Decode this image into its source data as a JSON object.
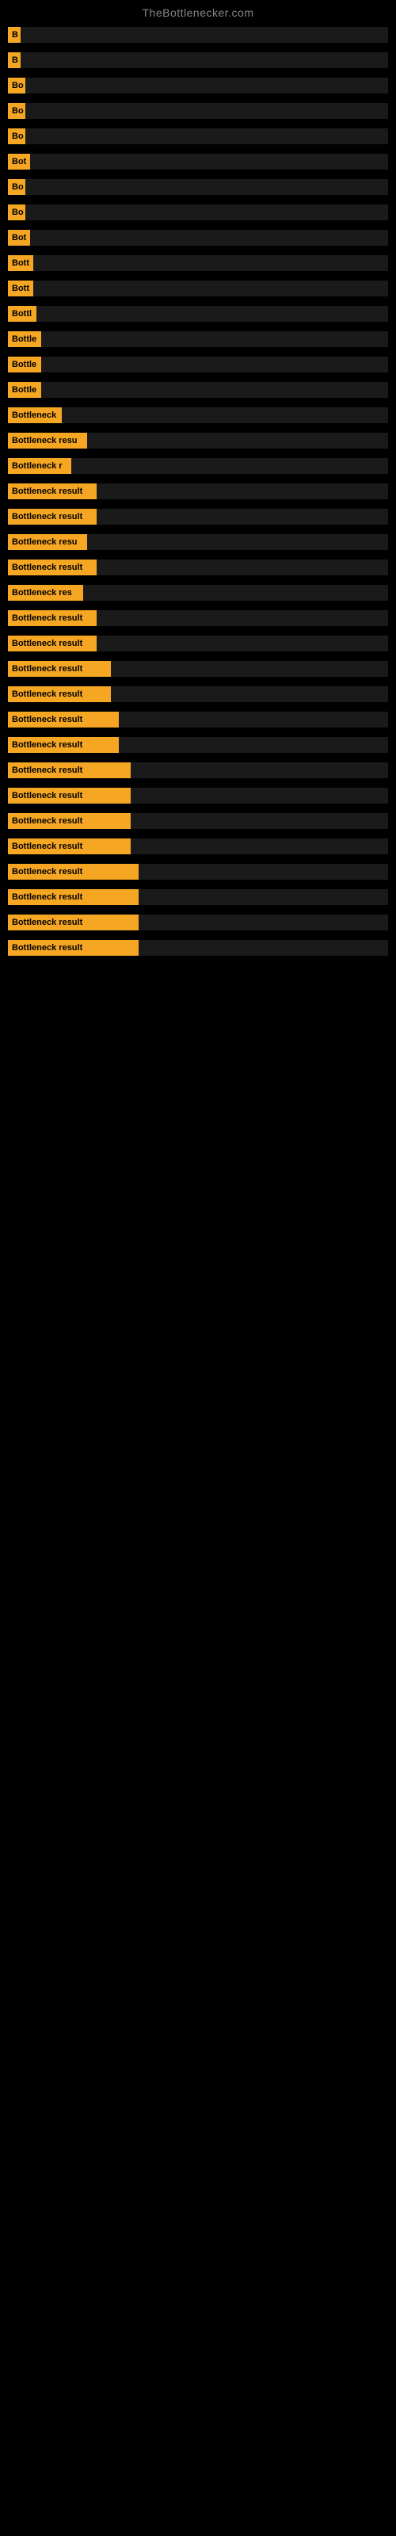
{
  "site_title": "TheBottlenecker.com",
  "rows": [
    {
      "label": "B",
      "label_width": 16,
      "bar_visible": true
    },
    {
      "label": "B",
      "label_width": 16,
      "bar_visible": true
    },
    {
      "label": "Bo",
      "label_width": 22,
      "bar_visible": true
    },
    {
      "label": "Bo",
      "label_width": 22,
      "bar_visible": true
    },
    {
      "label": "Bo",
      "label_width": 22,
      "bar_visible": true
    },
    {
      "label": "Bot",
      "label_width": 28,
      "bar_visible": true
    },
    {
      "label": "Bo",
      "label_width": 22,
      "bar_visible": true
    },
    {
      "label": "Bo",
      "label_width": 22,
      "bar_visible": true
    },
    {
      "label": "Bot",
      "label_width": 28,
      "bar_visible": true
    },
    {
      "label": "Bott",
      "label_width": 32,
      "bar_visible": true
    },
    {
      "label": "Bott",
      "label_width": 32,
      "bar_visible": true
    },
    {
      "label": "Bottl",
      "label_width": 36,
      "bar_visible": true
    },
    {
      "label": "Bottle",
      "label_width": 42,
      "bar_visible": true
    },
    {
      "label": "Bottle",
      "label_width": 42,
      "bar_visible": true
    },
    {
      "label": "Bottle",
      "label_width": 42,
      "bar_visible": true
    },
    {
      "label": "Bottleneck",
      "label_width": 68,
      "bar_visible": true
    },
    {
      "label": "Bottleneck resu",
      "label_width": 100,
      "bar_visible": true
    },
    {
      "label": "Bottleneck r",
      "label_width": 80,
      "bar_visible": true
    },
    {
      "label": "Bottleneck result",
      "label_width": 112,
      "bar_visible": true
    },
    {
      "label": "Bottleneck result",
      "label_width": 112,
      "bar_visible": true
    },
    {
      "label": "Bottleneck resu",
      "label_width": 100,
      "bar_visible": true
    },
    {
      "label": "Bottleneck result",
      "label_width": 112,
      "bar_visible": true
    },
    {
      "label": "Bottleneck res",
      "label_width": 95,
      "bar_visible": true
    },
    {
      "label": "Bottleneck result",
      "label_width": 112,
      "bar_visible": true
    },
    {
      "label": "Bottleneck result",
      "label_width": 112,
      "bar_visible": true
    },
    {
      "label": "Bottleneck result",
      "label_width": 130,
      "bar_visible": true
    },
    {
      "label": "Bottleneck result",
      "label_width": 130,
      "bar_visible": true
    },
    {
      "label": "Bottleneck result",
      "label_width": 140,
      "bar_visible": true
    },
    {
      "label": "Bottleneck result",
      "label_width": 140,
      "bar_visible": true
    },
    {
      "label": "Bottleneck result",
      "label_width": 155,
      "bar_visible": true
    },
    {
      "label": "Bottleneck result",
      "label_width": 155,
      "bar_visible": true
    },
    {
      "label": "Bottleneck result",
      "label_width": 155,
      "bar_visible": true
    },
    {
      "label": "Bottleneck result",
      "label_width": 155,
      "bar_visible": true
    },
    {
      "label": "Bottleneck result",
      "label_width": 165,
      "bar_visible": true
    },
    {
      "label": "Bottleneck result",
      "label_width": 165,
      "bar_visible": true
    },
    {
      "label": "Bottleneck result",
      "label_width": 165,
      "bar_visible": true
    },
    {
      "label": "Bottleneck result",
      "label_width": 165,
      "bar_visible": true
    }
  ]
}
